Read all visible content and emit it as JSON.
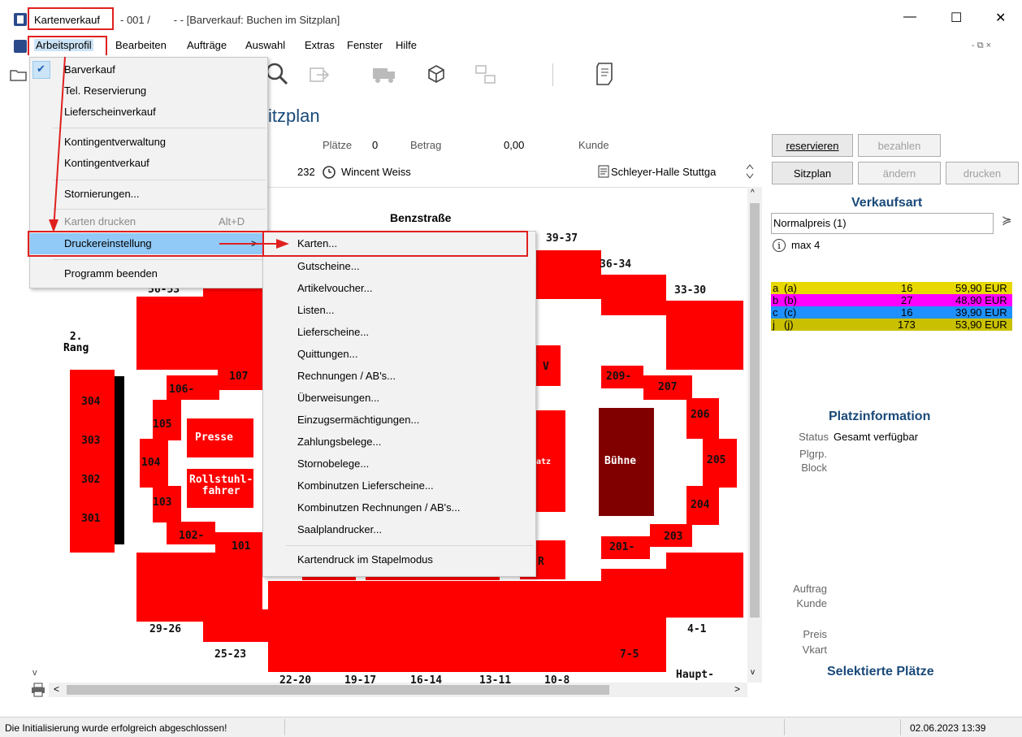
{
  "window": {
    "app_name": "Kartenverkauf",
    "title_rest": "- 001 /        - - [Barverkauf: Buchen im Sitzplan]",
    "minimize": "—",
    "maximize": "☐",
    "close": "✕",
    "inner_controls": "- ⧉ ×"
  },
  "menubar": [
    "Arbeitsprofil",
    "Bearbeiten",
    "Aufträge",
    "Auswahl",
    "Extras",
    "Fenster",
    "Hilfe"
  ],
  "page": {
    "title_fragment": "itzplan",
    "plaetze_label": "Plätze",
    "plaetze_value": "0",
    "betrag_label": "Betrag",
    "betrag_value": "0,00",
    "kunde_label": "Kunde",
    "event_no": "232",
    "event_name": "Wincent Weiss",
    "venue": "Schleyer-Halle Stuttga"
  },
  "buttons": {
    "reservieren": "reservieren",
    "bezahlen": "bezahlen",
    "sitzplan": "Sitzplan",
    "aendern": "ändern",
    "drucken": "drucken"
  },
  "verkaufsart": {
    "heading": "Verkaufsart",
    "selected": "Normalpreis (1)",
    "max": "max 4",
    "prices": [
      {
        "code": "a",
        "name": "(a)",
        "count": "16",
        "price": "59,90 EUR",
        "color": "#e8d800"
      },
      {
        "code": "b",
        "name": "(b)",
        "count": "27",
        "price": "48,90 EUR",
        "color": "#ff00ff"
      },
      {
        "code": "c",
        "name": "(c)",
        "count": "16",
        "price": "39,90 EUR",
        "color": "#1e90ff"
      },
      {
        "code": "j",
        "name": "(j)",
        "count": "173",
        "price": "53,90 EUR",
        "color": "#c8c000"
      }
    ]
  },
  "platzinfo": {
    "heading": "Platzinformation",
    "status_label": "Status",
    "status_value": "Gesamt verfügbar",
    "plgrp_label": "Plgrp.",
    "block_label": "Block",
    "auftrag_label": "Auftrag",
    "kunde_label": "Kunde",
    "preis_label": "Preis",
    "vkart_label": "Vkart",
    "selected_heading": "Selektierte Plätze"
  },
  "seatmap": {
    "street": "Benzstraße",
    "rang": "2.\nRang",
    "labels": {
      "b39_37": "39-37",
      "b36_34": "36-34",
      "b33_30": "33-30",
      "b56_53": "56-53",
      "r304": "304",
      "r303": "303",
      "r302": "302",
      "r301": "301",
      "b106": "106-",
      "b107": "107",
      "b105": "105",
      "b104": "104",
      "b103": "103",
      "b102": "102-",
      "b101": "101",
      "presse": "Presse",
      "rollstuhl": "Rollstuhl-\nfahrer",
      "bv": "V",
      "bR": "R",
      "batz": "atz",
      "b209": "209-",
      "b207": "207",
      "b206": "206",
      "b205": "205",
      "b204": "204",
      "b203": "203",
      "b201": "201-",
      "buehne": "Bühne",
      "b29_26": "29-26",
      "b25_23": "25-23",
      "b22_20": "22-20",
      "b19_17": "19-17",
      "b16_14": "16-14",
      "b13_11": "13-11",
      "b10_8": "10-8",
      "b7_5": "7-5",
      "b4_1": "4-1",
      "haupt": "Haupt-"
    }
  },
  "dropdown_main": [
    {
      "label": "Barverkauf",
      "checked": true,
      "disabled": false
    },
    {
      "label": "Tel. Reservierung",
      "checked": false,
      "disabled": false
    },
    {
      "label": "Lieferscheinverkauf",
      "checked": false,
      "disabled": false
    },
    {
      "label": "Kontingentverwaltung",
      "checked": false,
      "disabled": false
    },
    {
      "label": "Kontingentverkauf",
      "checked": false,
      "disabled": false
    },
    {
      "label": "Stornierungen...",
      "checked": false,
      "disabled": false
    },
    {
      "label": "Karten drucken",
      "shortcut": "Alt+D",
      "checked": false,
      "disabled": true
    },
    {
      "label": "Druckereinstellung",
      "arrow": ">",
      "checked": false,
      "disabled": false,
      "highlighted": true
    },
    {
      "label": "Programm beenden",
      "checked": false,
      "disabled": false
    }
  ],
  "dropdown_sub": [
    "Karten...",
    "Gutscheine...",
    "Artikelvoucher...",
    "Listen...",
    "Lieferscheine...",
    "Quittungen...",
    "Rechnungen / AB's...",
    "Überweisungen...",
    "Einzugsermächtigungen...",
    "Zahlungsbelege...",
    "Stornobelege...",
    "Kombinutzen Lieferscheine...",
    "Kombinutzen Rechnungen / AB's...",
    "Saalplandrucker...",
    "Kartendruck im Stapelmodus"
  ],
  "statusbar": {
    "message": "Die Initialisierung wurde erfolgreich abgeschlossen!",
    "datetime": "02.06.2023 13:39"
  }
}
